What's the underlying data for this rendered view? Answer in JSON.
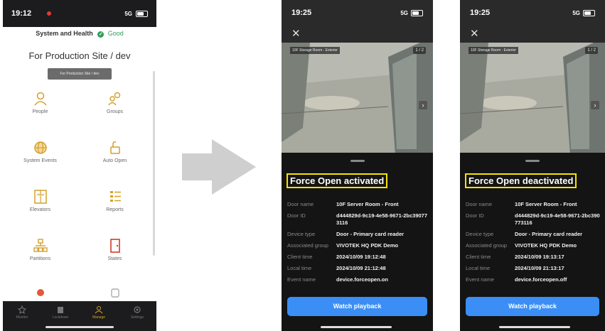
{
  "screen1": {
    "time": "19:12",
    "signal": "5G",
    "health_label": "System and Health",
    "health_status": "Good",
    "site_title": "For Production Site / dev",
    "site_chip": "For Production Site / dev",
    "tiles": [
      {
        "label": "People",
        "icon": "person-icon"
      },
      {
        "label": "Groups",
        "icon": "groups-icon"
      },
      {
        "label": "System Events",
        "icon": "globe-icon"
      },
      {
        "label": "Auto Open",
        "icon": "unlock-icon"
      },
      {
        "label": "Elevators",
        "icon": "elevator-icon"
      },
      {
        "label": "Reports",
        "icon": "reports-icon"
      },
      {
        "label": "Partitions",
        "icon": "partition-icon"
      },
      {
        "label": "States",
        "icon": "door-icon"
      }
    ],
    "tabs": [
      "Monitor",
      "Lockdown",
      "Manage",
      "Settings"
    ],
    "active_tab": "Manage"
  },
  "screen2": {
    "time": "19:25",
    "signal": "5G",
    "camera_label": "10F Storage Room - Exterior",
    "page": "1 / 2",
    "headline": "Force Open activated",
    "details": [
      {
        "key": "Door name",
        "value": "10F Server Room - Front"
      },
      {
        "key": "Door ID",
        "value": "d444829d-9c19-4e58-9671-2bc390773116"
      },
      {
        "key": "Device type",
        "value": "Door - Primary card reader"
      },
      {
        "key": "Associated group",
        "value": "VIVOTEK HQ PDK Demo"
      },
      {
        "key": "Client time",
        "value": "2024/10/09 19:12:48"
      },
      {
        "key": "Local time",
        "value": "2024/10/09 21:12:48"
      },
      {
        "key": "Event name",
        "value": "device.forceopen.on"
      }
    ],
    "button": "Watch playback"
  },
  "screen3": {
    "time": "19:25",
    "signal": "5G",
    "camera_label": "10F Storage Room - Exterior",
    "page": "1 / 2",
    "headline": "Force Open deactivated",
    "details": [
      {
        "key": "Door name",
        "value": "10F Server Room - Front"
      },
      {
        "key": "Door ID",
        "value": "d444829d-9c19-4e58-9671-2bc390773116"
      },
      {
        "key": "Device type",
        "value": "Door - Primary card reader"
      },
      {
        "key": "Associated group",
        "value": "VIVOTEK HQ PDK Demo"
      },
      {
        "key": "Client time",
        "value": "2024/10/09 19:13:17"
      },
      {
        "key": "Local time",
        "value": "2024/10/09 21:13:17"
      },
      {
        "key": "Event name",
        "value": "device.forceopen.off"
      }
    ],
    "button": "Watch playback"
  },
  "colors": {
    "accent": "#d4a02a",
    "good": "#2e9e5b",
    "highlight": "#f5e400",
    "button": "#3a8ef5"
  }
}
